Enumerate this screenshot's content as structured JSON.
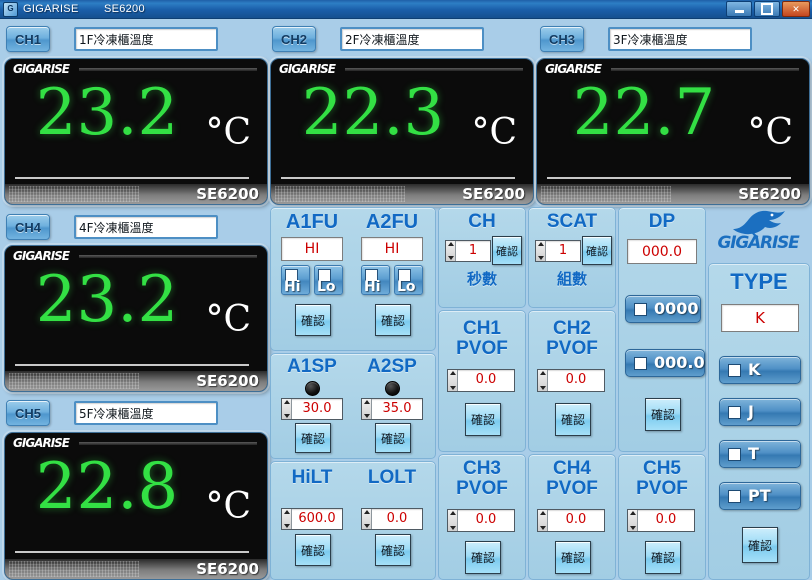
{
  "window": {
    "app_name": "GIGARISE",
    "model": "SE6200",
    "icon": "app-icon",
    "buttons": {
      "minimize": "minimize-icon",
      "maximize": "maximize-icon",
      "close": "✕"
    }
  },
  "channels": [
    {
      "id": "CH1",
      "name": "1F冷凍櫃溫度",
      "value": "23.2",
      "unit": "°C",
      "model": "SE6200",
      "brand": "GIGARISE"
    },
    {
      "id": "CH2",
      "name": "2F冷凍櫃溫度",
      "value": "22.3",
      "unit": "°C",
      "model": "SE6200",
      "brand": "GIGARISE"
    },
    {
      "id": "CH3",
      "name": "3F冷凍櫃溫度",
      "value": "22.7",
      "unit": "°C",
      "model": "SE6200",
      "brand": "GIGARISE"
    },
    {
      "id": "CH4",
      "name": "4F冷凍櫃溫度",
      "value": "23.2",
      "unit": "°C",
      "model": "SE6200",
      "brand": "GIGARISE"
    },
    {
      "id": "CH5",
      "name": "5F冷凍櫃溫度",
      "value": "22.8",
      "unit": "°C",
      "model": "SE6200",
      "brand": "GIGARISE"
    }
  ],
  "confirm_label": "確認",
  "alarm": {
    "a1fu": {
      "title": "A1FU",
      "value": "HI",
      "hi_label": "Hi",
      "lo_label": "Lo"
    },
    "a2fu": {
      "title": "A2FU",
      "value": "HI",
      "hi_label": "Hi",
      "lo_label": "Lo"
    },
    "a1sp": {
      "title": "A1SP",
      "value": "30.0"
    },
    "a2sp": {
      "title": "A2SP",
      "value": "35.0"
    },
    "hilt": {
      "title": "HiLT",
      "value": "600.0"
    },
    "lolt": {
      "title": "LOLT",
      "value": "0.0"
    }
  },
  "scan": {
    "ch": {
      "title": "CH",
      "value": "1",
      "caption": "秒數"
    },
    "scat": {
      "title": "SCAT",
      "value": "1",
      "caption": "組數"
    }
  },
  "pvof": [
    {
      "title": "CH1\nPVOF",
      "line1": "CH1",
      "line2": "PVOF",
      "value": "0.0"
    },
    {
      "title": "CH2\nPVOF",
      "line1": "CH2",
      "line2": "PVOF",
      "value": "0.0"
    },
    {
      "title": "CH3\nPVOF",
      "line1": "CH3",
      "line2": "PVOF",
      "value": "0.0"
    },
    {
      "title": "CH4\nPVOF",
      "line1": "CH4",
      "line2": "PVOF",
      "value": "0.0"
    },
    {
      "title": "CH5\nPVOF",
      "line1": "CH5",
      "line2": "PVOF",
      "value": "0.0"
    }
  ],
  "dp": {
    "title": "DP",
    "value": "000.0",
    "options": [
      {
        "label": "0000"
      },
      {
        "label": "000.0"
      }
    ]
  },
  "type": {
    "brand": "GIGARISE",
    "title": "TYPE",
    "value": "K",
    "options": [
      {
        "label": "K"
      },
      {
        "label": "J"
      },
      {
        "label": "T"
      },
      {
        "label": "PT"
      }
    ]
  },
  "colors": {
    "background": "#a9cde8",
    "titlebar": "#1a5ea9",
    "led_green": "#33e044",
    "value_red": "#cc0000",
    "heading_blue": "#1169c4"
  }
}
